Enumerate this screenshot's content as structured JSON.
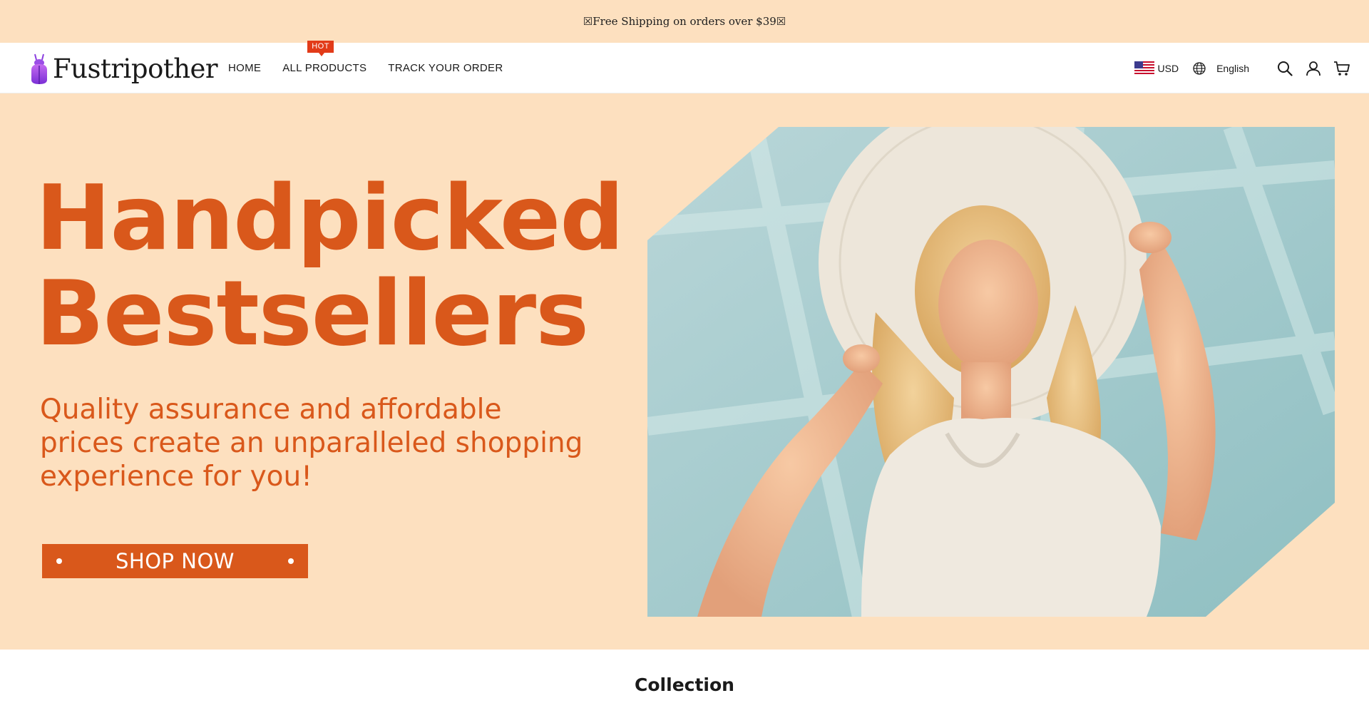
{
  "announcement": {
    "text": "☒Free Shipping on orders over $39☒"
  },
  "brand": {
    "name": "Fustripother",
    "logo_icon": "beetle-logo-icon"
  },
  "nav": {
    "items": [
      {
        "label": "HOME"
      },
      {
        "label": "ALL PRODUCTS",
        "badge": "HOT"
      },
      {
        "label": "TRACK YOUR ORDER"
      }
    ]
  },
  "header_right": {
    "currency": "USD",
    "currency_icon": "us-flag-icon",
    "language": "English",
    "language_icon": "globe-icon",
    "icons": [
      "search-icon",
      "account-icon",
      "cart-icon"
    ]
  },
  "hero": {
    "headline_line1": "Handpicked",
    "headline_line2": "Bestsellers",
    "subtitle_line1": "Quality assurance and affordable",
    "subtitle_line2": "prices create an unparalleled shopping",
    "subtitle_line3": "experience for you!",
    "button_label": "SHOP NOW",
    "image_label": "woman in sun hat"
  },
  "collection": {
    "title": "Collection"
  },
  "colors": {
    "accent": "#d9581b",
    "background_peach": "#fde0bf",
    "badge_red": "#e23b18"
  }
}
